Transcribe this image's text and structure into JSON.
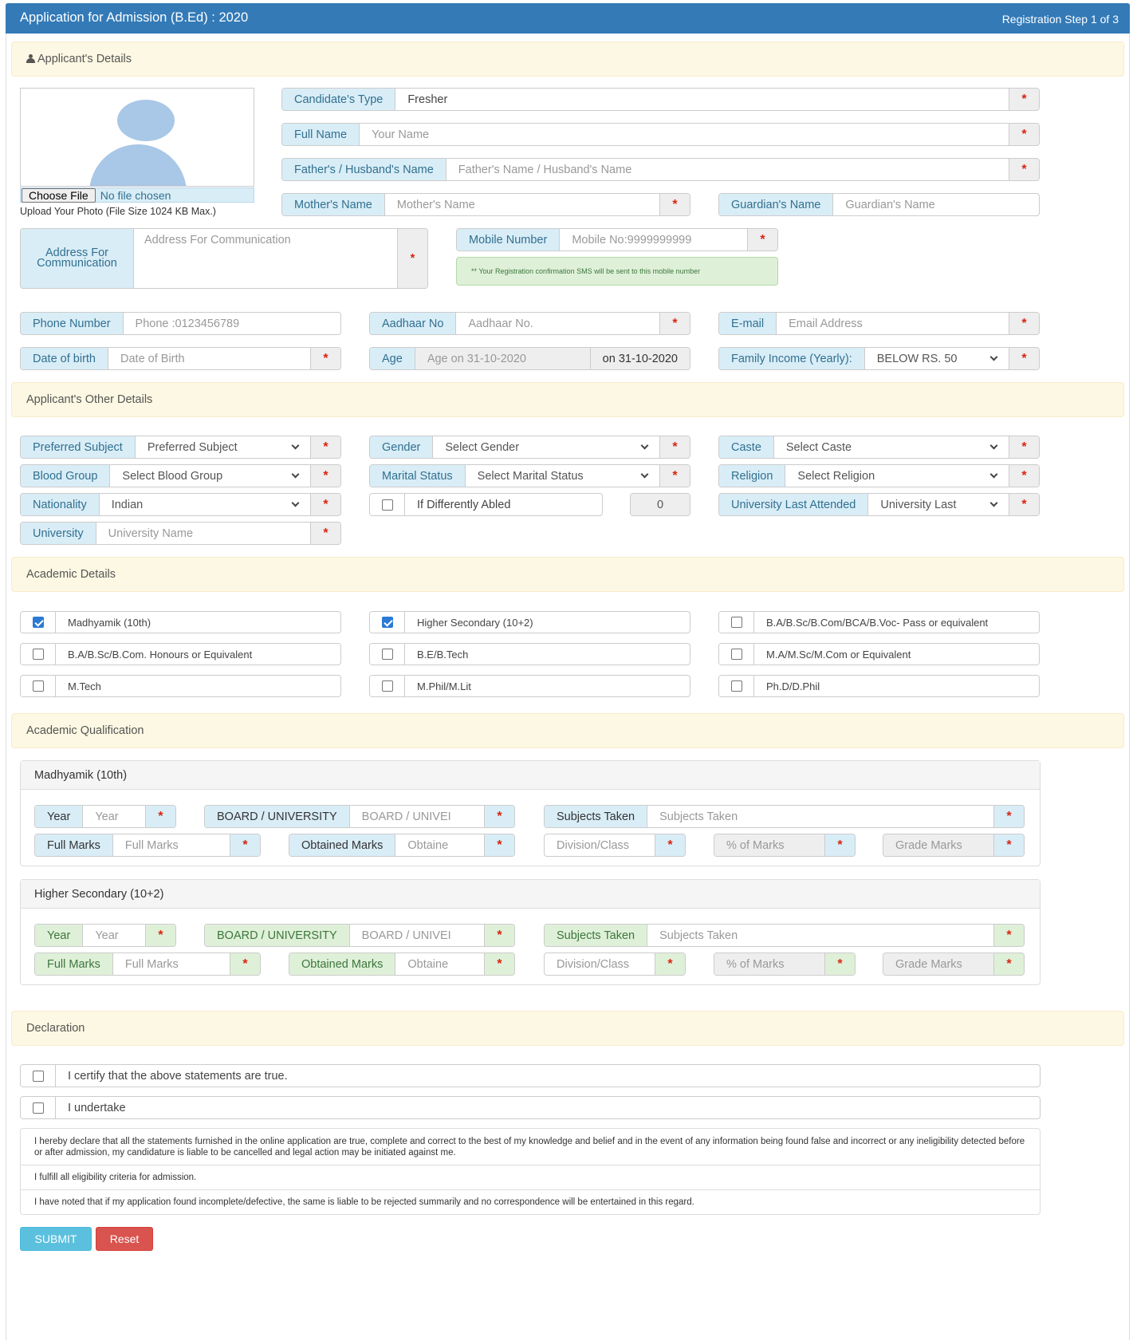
{
  "header": {
    "title": "Application for Admission (B.Ed) : 2020",
    "step": "Registration Step 1 of 3"
  },
  "sections": {
    "applicant": "Applicant's Details",
    "other": "Applicant's Other Details",
    "academic": "Academic Details",
    "qualification": "Academic Qualification",
    "declaration": "Declaration"
  },
  "photo": {
    "choose_file": "Choose File",
    "no_file": "No file chosen",
    "note": "Upload Your Photo (File Size 1024 KB Max.)"
  },
  "applicant": {
    "candidate_type": {
      "label": "Candidate's Type",
      "value": "Fresher"
    },
    "full_name": {
      "label": "Full Name",
      "placeholder": "Your Name"
    },
    "father_name": {
      "label": "Father's / Husband's Name",
      "placeholder": "Father's Name / Husband's Name"
    },
    "mother_name": {
      "label": "Mother's Name",
      "placeholder": "Mother's Name"
    },
    "guardian_name": {
      "label": "Guardian's Name",
      "placeholder": "Guardian's Name"
    },
    "address": {
      "label": "Address For Communication",
      "placeholder": "Address For Communication"
    },
    "mobile": {
      "label": "Mobile Number",
      "placeholder": "Mobile No:9999999999"
    },
    "sms_note": "** Your Registration confirmation SMS will be sent to this mobile number",
    "phone": {
      "label": "Phone Number",
      "placeholder": "Phone :0123456789"
    },
    "aadhaar": {
      "label": "Aadhaar No",
      "placeholder": "Aadhaar No."
    },
    "email": {
      "label": "E-mail",
      "placeholder": "Email Address"
    },
    "dob": {
      "label": "Date of birth",
      "placeholder": "Date of Birth"
    },
    "age": {
      "label": "Age",
      "placeholder": "Age on 31-10-2020",
      "suffix": "on 31-10-2020"
    },
    "income": {
      "label": "Family Income (Yearly):",
      "value": "BELOW RS. 50"
    }
  },
  "other": {
    "preferred_subject": {
      "label": "Preferred Subject",
      "value": "Preferred Subject"
    },
    "gender": {
      "label": "Gender",
      "value": "Select Gender"
    },
    "caste": {
      "label": "Caste",
      "value": "Select Caste"
    },
    "blood_group": {
      "label": "Blood Group",
      "value": "Select Blood Group"
    },
    "marital_status": {
      "label": "Marital Status",
      "value": "Select Marital Status"
    },
    "religion": {
      "label": "Religion",
      "value": "Select Religion"
    },
    "nationality": {
      "label": "Nationality",
      "value": "Indian"
    },
    "differently_abled": {
      "label": "If Differently Abled",
      "value": "0"
    },
    "university_last": {
      "label": "University Last Attended",
      "value": "University Last"
    },
    "university": {
      "label": "University",
      "placeholder": "University Name"
    }
  },
  "academic_details": [
    {
      "label": "Madhyamik (10th)",
      "checked": true
    },
    {
      "label": "Higher Secondary (10+2)",
      "checked": true
    },
    {
      "label": "B.A/B.Sc/B.Com/BCA/B.Voc- Pass or equivalent",
      "checked": false
    },
    {
      "label": "B.A/B.Sc/B.Com. Honours or Equivalent",
      "checked": false
    },
    {
      "label": "B.E/B.Tech",
      "checked": false
    },
    {
      "label": "M.A/M.Sc/M.Com or Equivalent",
      "checked": false
    },
    {
      "label": "M.Tech",
      "checked": false
    },
    {
      "label": "M.Phil/M.Lit",
      "checked": false
    },
    {
      "label": "Ph.D/D.Phil",
      "checked": false
    }
  ],
  "qualification": {
    "madhyamik": {
      "title": "Madhyamik (10th)",
      "year": {
        "label": "Year",
        "placeholder": "Year"
      },
      "board": {
        "label": "BOARD / UNIVERSITY",
        "placeholder": "BOARD / UNIVEI"
      },
      "subjects": {
        "label": "Subjects Taken",
        "placeholder": "Subjects Taken"
      },
      "full_marks": {
        "label": "Full Marks",
        "placeholder": "Full Marks"
      },
      "obtained": {
        "label": "Obtained Marks",
        "placeholder": "Obtaine"
      },
      "division": {
        "placeholder": "Division/Class"
      },
      "percent": {
        "placeholder": "% of Marks"
      },
      "grade": {
        "placeholder": "Grade Marks"
      }
    },
    "hs": {
      "title": "Higher Secondary (10+2)",
      "year": {
        "label": "Year",
        "placeholder": "Year"
      },
      "board": {
        "label": "BOARD / UNIVERSITY",
        "placeholder": "BOARD / UNIVEI"
      },
      "subjects": {
        "label": "Subjects Taken",
        "placeholder": "Subjects Taken"
      },
      "full_marks": {
        "label": "Full Marks",
        "placeholder": "Full Marks"
      },
      "obtained": {
        "label": "Obtained Marks",
        "placeholder": "Obtaine"
      },
      "division": {
        "placeholder": "Division/Class"
      },
      "percent": {
        "placeholder": "% of Marks"
      },
      "grade": {
        "placeholder": "Grade Marks"
      }
    }
  },
  "declaration": {
    "certify": "I certify that the above statements are true.",
    "undertake": "I undertake",
    "stmt1": "I hereby declare that all the statements furnished in the online application are true, complete and correct to the best of my knowledge and belief and in the event of any information being found false and incorrect or any ineligibility detected before or after admission, my candidature is liable to be cancelled and legal action may be initiated against me.",
    "stmt2": "I fulfill all eligibility criteria for admission.",
    "stmt3": "I have noted that if my application found incomplete/defective, the same is liable to be rejected summarily and no correspondence will be entertained in this regard."
  },
  "buttons": {
    "submit": "SUBMIT",
    "reset": "Reset"
  },
  "required_mark": "*",
  "colors": {
    "header": "#337ab7",
    "addon_blue": "#d9edf7",
    "addon_green": "#dff0d8",
    "section": "#fcf8e3",
    "required": "#d9230f"
  }
}
